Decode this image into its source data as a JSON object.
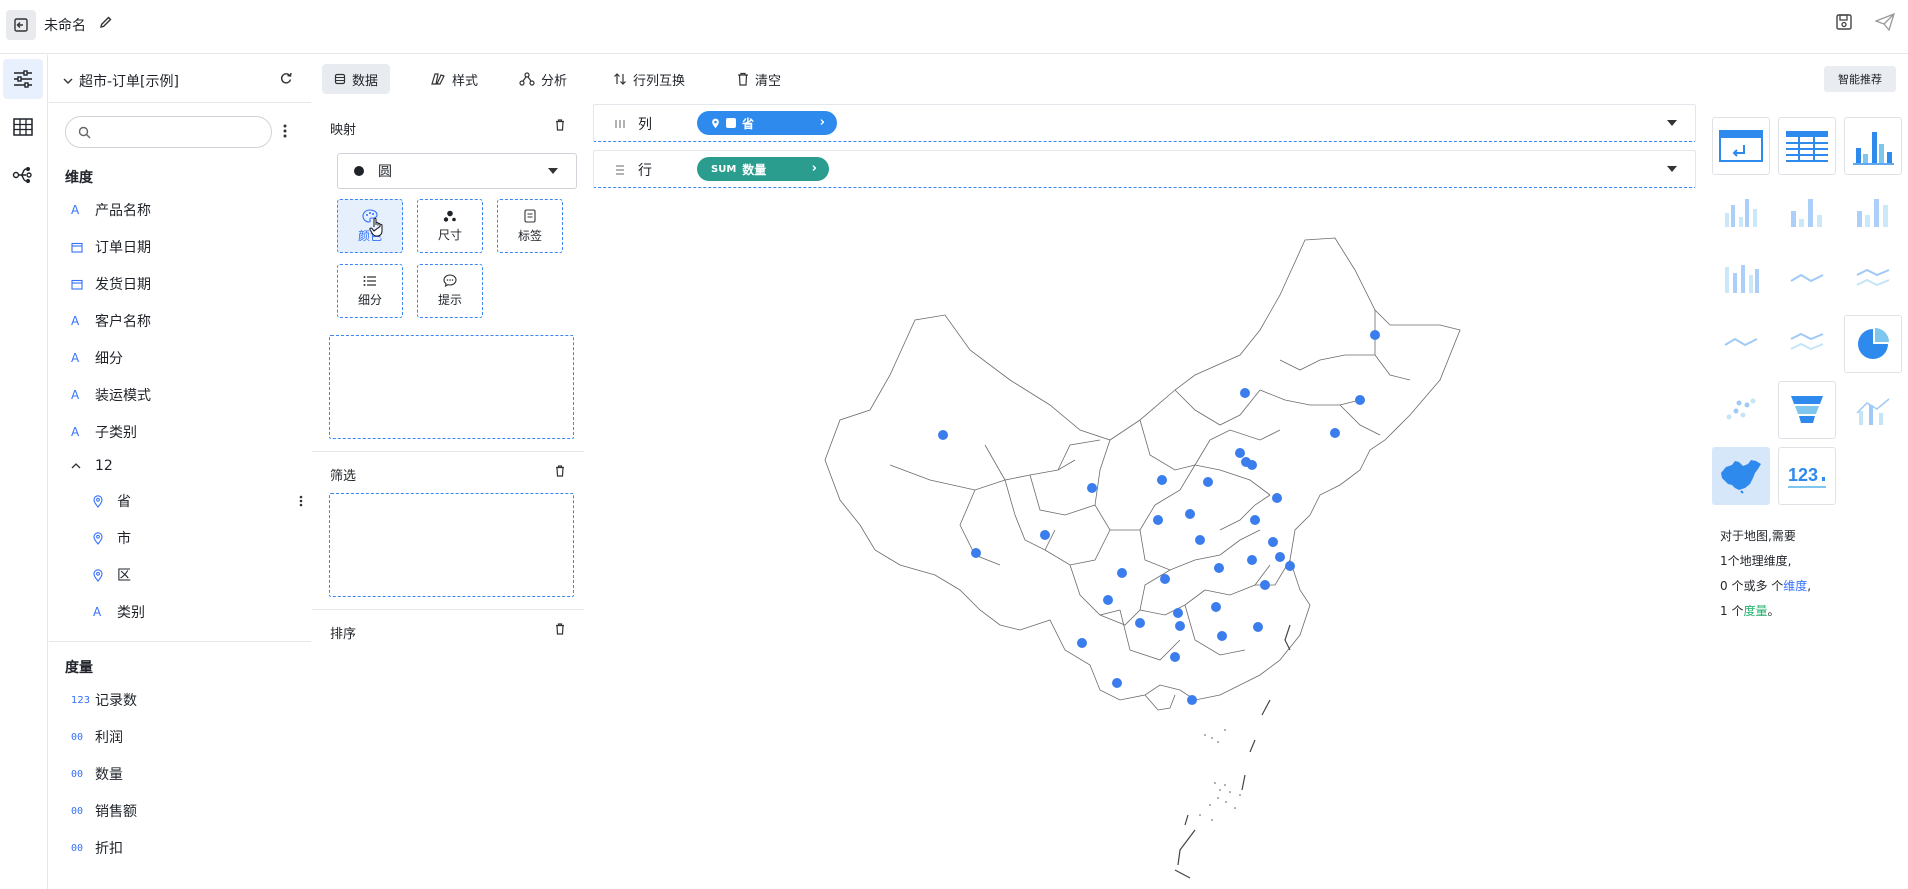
{
  "header": {
    "title": "未命名"
  },
  "datasource": {
    "name": "超市-订单[示例]"
  },
  "search": {
    "placeholder": ""
  },
  "dimensions": {
    "title": "维度",
    "items": [
      {
        "type": "A",
        "label": "产品名称"
      },
      {
        "type": "cal",
        "label": "订单日期"
      },
      {
        "type": "cal",
        "label": "发货日期"
      },
      {
        "type": "A",
        "label": "客户名称"
      },
      {
        "type": "A",
        "label": "细分"
      },
      {
        "type": "A",
        "label": "装运模式"
      },
      {
        "type": "A",
        "label": "子类别"
      }
    ],
    "group": {
      "label": "12",
      "items": [
        {
          "type": "geo",
          "label": "省"
        },
        {
          "type": "geo",
          "label": "市"
        },
        {
          "type": "geo",
          "label": "区"
        },
        {
          "type": "A",
          "label": "类别"
        }
      ]
    }
  },
  "measures": {
    "title": "度量",
    "items": [
      {
        "type": "123",
        "label": "记录数"
      },
      {
        "type": "00",
        "label": "利润"
      },
      {
        "type": "00",
        "label": "数量"
      },
      {
        "type": "00",
        "label": "销售额"
      },
      {
        "type": "00",
        "label": "折扣"
      }
    ]
  },
  "toolbar": {
    "data": "数据",
    "style": "样式",
    "analysis": "分析",
    "swap": "行列互换",
    "clear": "清空",
    "smart": "智能推荐"
  },
  "mapping": {
    "title": "映射",
    "mark_type": "圆",
    "color": "颜色",
    "size": "尺寸",
    "label": "标签",
    "detail": "细分",
    "tooltip": "提示"
  },
  "filter": {
    "title": "筛选"
  },
  "sort": {
    "title": "排序"
  },
  "shelves": {
    "columns": {
      "label": "列",
      "pill": "省"
    },
    "rows": {
      "label": "行",
      "agg": "SUM",
      "pill": "数量"
    }
  },
  "hint": {
    "line1": "对于地图,需要",
    "line2": "1个地理维度,",
    "line3a": "0 个或多 个",
    "line3b": "维度",
    "line3c": ",",
    "line4a": "1 个",
    "line4b": "度量",
    "line4c": "。"
  },
  "colors": {
    "accent": "#3370ff",
    "pill_blue": "#2f8aee",
    "pill_green": "#2a9d8f",
    "point": "#3b7ded"
  }
}
